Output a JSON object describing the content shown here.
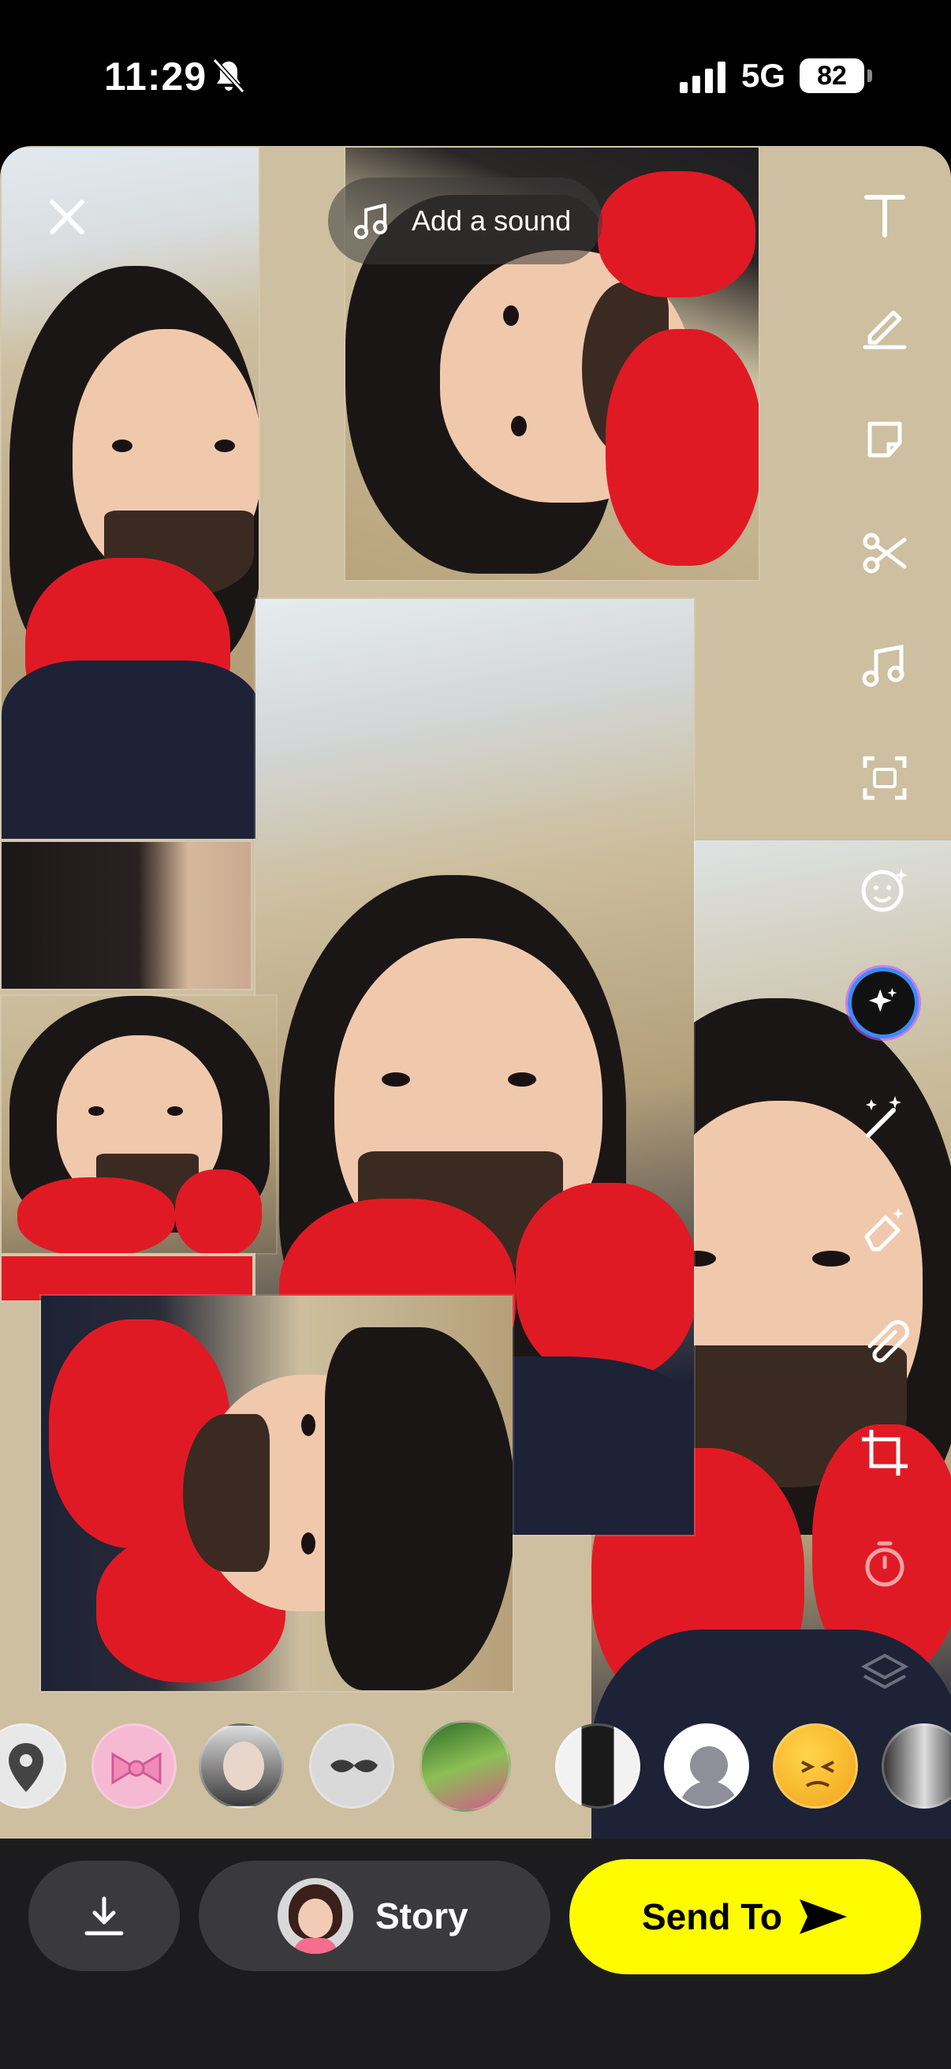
{
  "status_bar": {
    "time": "11:29",
    "network": "5G",
    "battery": "82",
    "icons": [
      "bell-slash-icon",
      "signal-icon",
      "battery-icon"
    ]
  },
  "editor": {
    "close_icon": "close-icon",
    "sound_label": "Add a sound",
    "sound_icon": "music-note-icon",
    "tools": [
      "text-icon",
      "pencil-icon",
      "sticker-icon",
      "scissors-icon",
      "music-icon",
      "scan-icon",
      "emoji-sparkle-icon",
      "ai-sparkle-icon",
      "magic-wand-icon",
      "eraser-icon",
      "paperclip-icon",
      "crop-icon",
      "timer-icon",
      "layers-icon"
    ]
  },
  "lenses": [
    "location-pin-lens",
    "bow-lens",
    "friend-lens-1",
    "mustache-lens",
    "photo-lens",
    "friend-lens-2",
    "avatar-lens",
    "emoji-lens",
    "collage-lens"
  ],
  "bottom_bar": {
    "save_icon": "download-icon",
    "story_label": "Story",
    "send_label": "Send To",
    "send_icon": "send-arrow-icon"
  },
  "colors": {
    "send_yellow": "#fffc00",
    "pillow_red": "#e01a24",
    "bar_bg": "#1c1c1e",
    "button_gray": "#3a3a3c"
  }
}
